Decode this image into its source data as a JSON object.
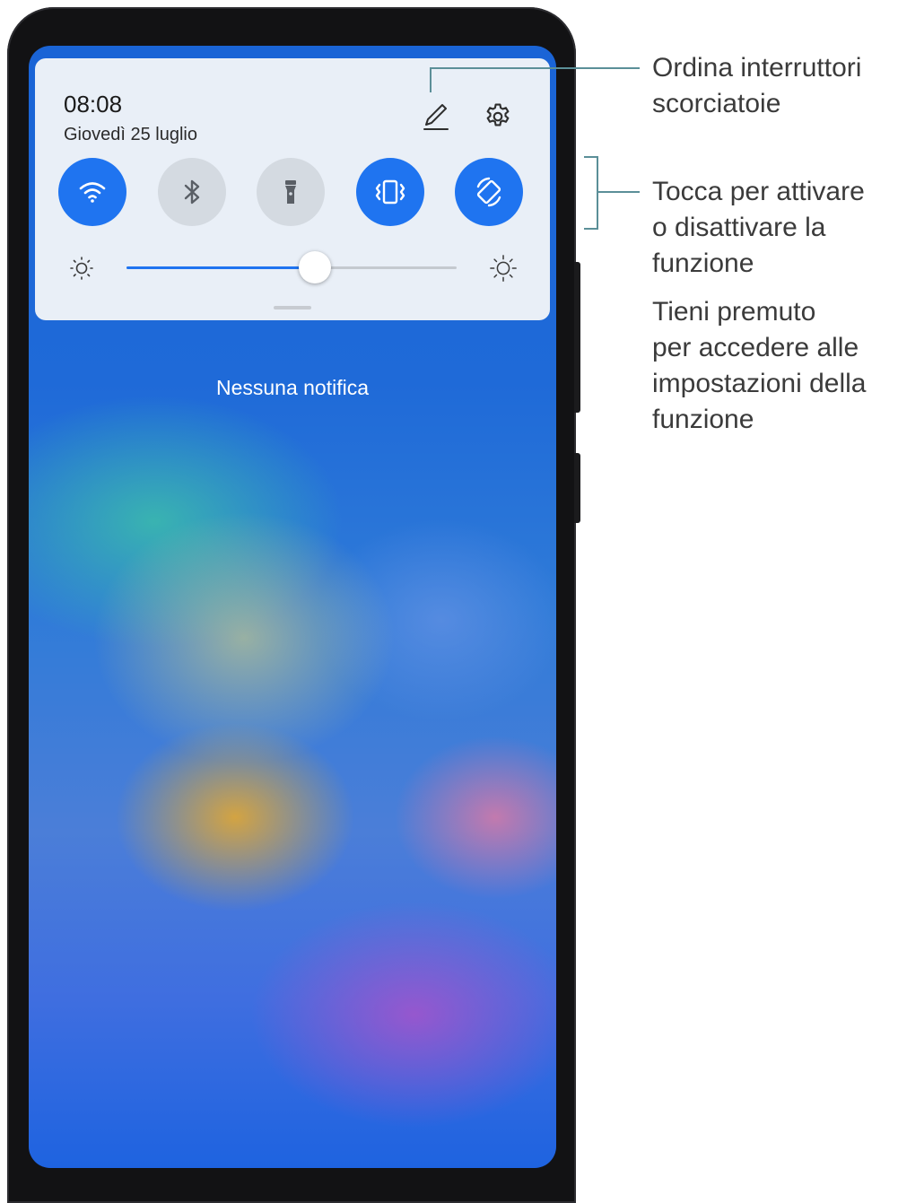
{
  "status": {
    "time": "08:08",
    "date": "Giovedì 25 luglio"
  },
  "header_actions": [
    {
      "name": "edit-icon"
    },
    {
      "name": "gear-icon"
    }
  ],
  "toggles": [
    {
      "name": "wifi-toggle",
      "icon": "wifi-icon",
      "state": "on"
    },
    {
      "name": "bluetooth-toggle",
      "icon": "bluetooth-icon",
      "state": "off"
    },
    {
      "name": "flashlight-toggle",
      "icon": "flashlight-icon",
      "state": "off"
    },
    {
      "name": "vibration-toggle",
      "icon": "vibration-icon",
      "state": "on"
    },
    {
      "name": "auto-rotate-toggle",
      "icon": "rotate-icon",
      "state": "on"
    }
  ],
  "brightness": {
    "level": 0.57
  },
  "notifications": {
    "empty_text": "Nessuna notifica"
  },
  "callouts": {
    "edit": [
      "Ordina interruttori",
      "scorciatoie"
    ],
    "toggle_tap": [
      "Tocca per attivare",
      "o disattivare la",
      "funzione"
    ],
    "toggle_hold": [
      "Tieni premuto",
      "per accedere alle",
      "impostazioni della",
      "funzione"
    ]
  },
  "colors": {
    "accent": "#1f74f0",
    "panel": "#e9eff7",
    "callout_line": "#5b8f98",
    "callout_text": "#3b3b3b"
  }
}
